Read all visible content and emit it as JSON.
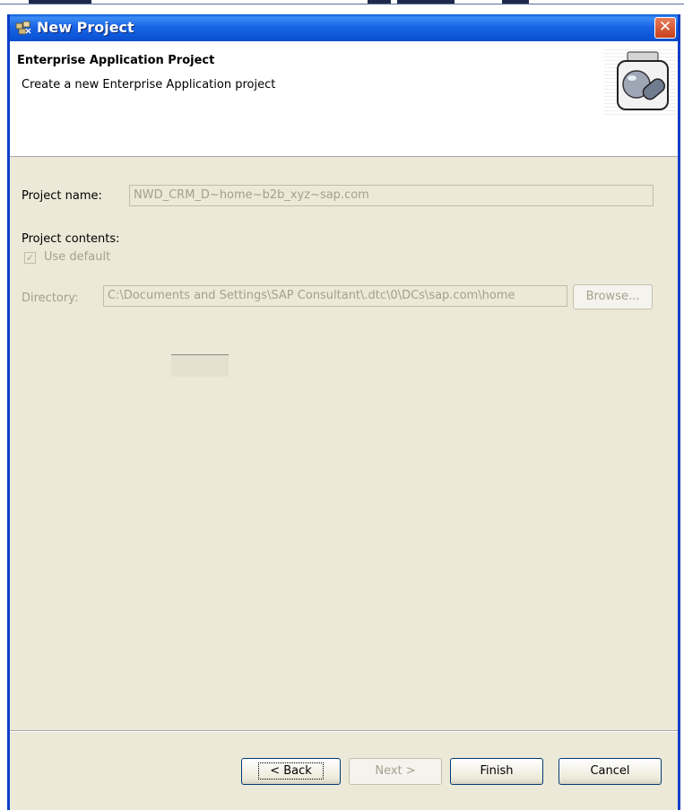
{
  "window": {
    "title": "New Project",
    "close_symbol": "✕"
  },
  "header": {
    "title": "Enterprise Application Project",
    "description": "Create a new Enterprise Application project",
    "image_icon": "wizard-jar-icon"
  },
  "form": {
    "project_name_label": "Project name:",
    "project_name_value": "NWD_CRM_D~home~b2b_xyz~sap.com",
    "project_contents_label": "Project contents:",
    "use_default_label": "Use default",
    "use_default_checked": true,
    "directory_label": "Directory:",
    "directory_value": "C:\\Documents and Settings\\SAP Consultant\\.dtc\\0\\DCs\\sap.com\\home",
    "browse_label": "Browse..."
  },
  "buttons": {
    "back": "< Back",
    "next": "Next >",
    "finish": "Finish",
    "cancel": "Cancel"
  },
  "colors": {
    "titlebar": "#0a5be0",
    "dialog_bg": "#ece9d8",
    "disabled_text": "#a3a28c"
  }
}
